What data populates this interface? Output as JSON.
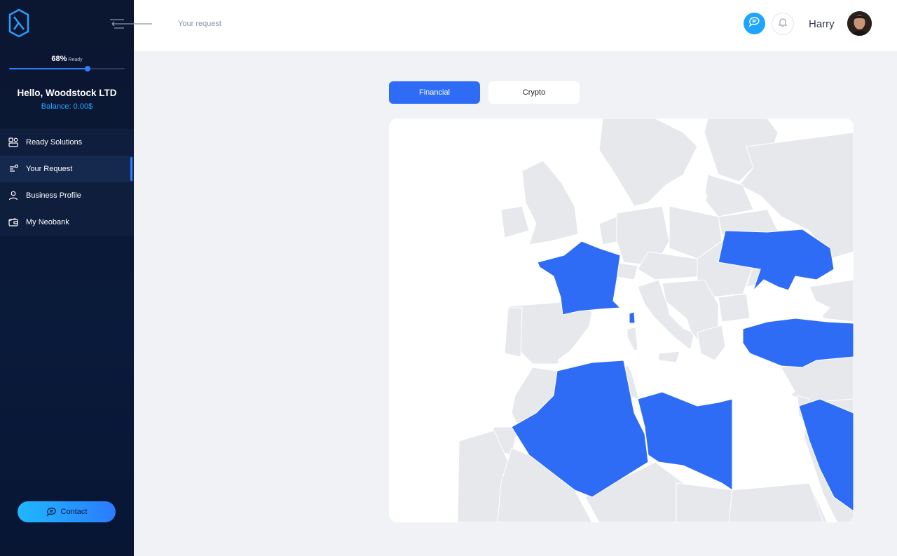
{
  "app": {
    "progress_percent": 68,
    "progress_value": "68%",
    "progress_suffix": "Ready",
    "greeting": "Hello, Woodstock LTD",
    "balance": "Balance: 0.00$"
  },
  "sidebar": {
    "items": [
      {
        "label": "Ready Solutions",
        "icon": "solutions-icon",
        "active": false
      },
      {
        "label": "Your Request",
        "icon": "request-icon",
        "active": true
      },
      {
        "label": "Business Profile",
        "icon": "user-icon",
        "active": false
      },
      {
        "label": "My Neobank",
        "icon": "wallet-icon",
        "active": false
      }
    ],
    "contact_label": "Contact"
  },
  "header": {
    "breadcrumb": "Your request",
    "user_name": "Harry"
  },
  "tabs": [
    {
      "label": "Financial",
      "active": true
    },
    {
      "label": "Crypto",
      "active": false
    }
  ],
  "map": {
    "highlighted_countries": [
      "France",
      "Ukraine",
      "Turkey",
      "Algeria",
      "Libya",
      "Egypt"
    ],
    "highlight_color": "#2f6cf6",
    "base_color": "#e6e8ec"
  },
  "colors": {
    "accent": "#2f6cf6",
    "sidebar_bg": "#0b1630",
    "balance": "#27a9ff"
  }
}
